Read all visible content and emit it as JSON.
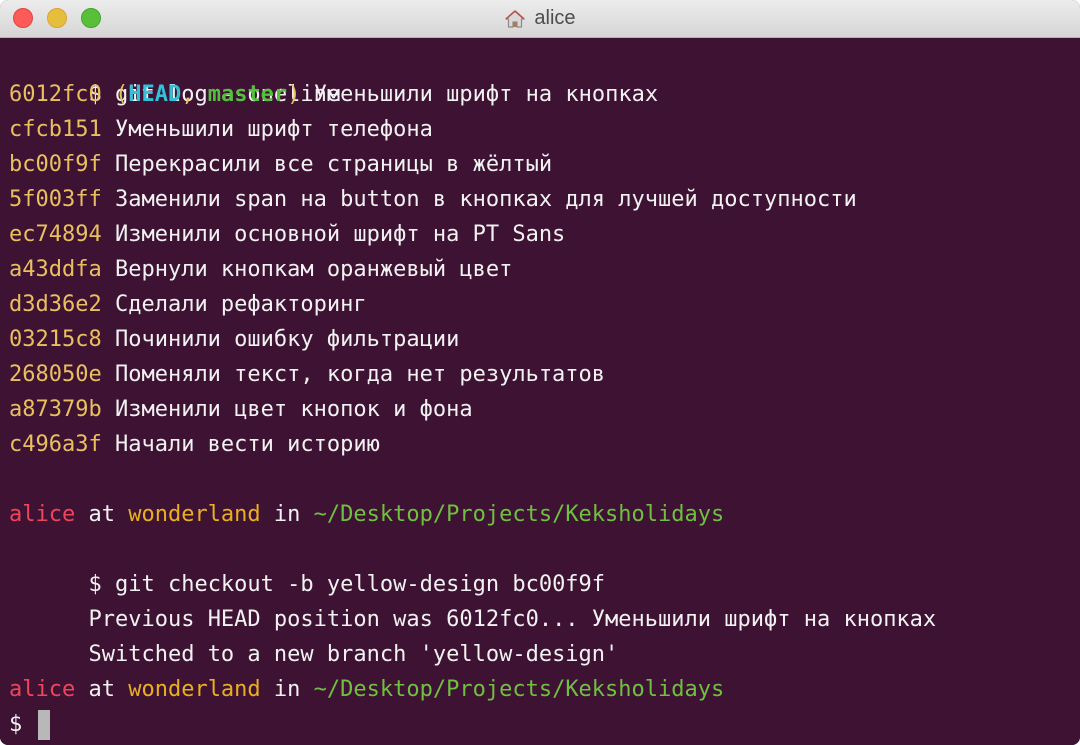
{
  "window": {
    "title": "alice",
    "colors": {
      "background": "#3e1233",
      "text": "#f2f2f2",
      "hash": "#e8c060",
      "head": "#33c0d8",
      "branch": "#55c040",
      "user": "#f0445c",
      "host": "#e8b020",
      "path": "#70c040"
    },
    "icon": "home-icon"
  },
  "terminal": {
    "command1": "$ git log --oneline",
    "log": [
      {
        "hash": "6012fc0",
        "message": "Уменьшили шрифт на кнопках"
      },
      {
        "hash": "cfcb151",
        "message": "Уменьшили шрифт телефона"
      },
      {
        "hash": "bc00f9f",
        "message": "Перекрасили все страницы в жёлтый"
      },
      {
        "hash": "5f003ff",
        "message": "Заменили span на button в кнопках для лучшей доступности"
      },
      {
        "hash": "ec74894",
        "message": "Изменили основной шрифт на PT Sans"
      },
      {
        "hash": "a43ddfa",
        "message": "Вернули кнопкам оранжевый цвет"
      },
      {
        "hash": "d3d36e2",
        "message": "Сделали рефакторинг"
      },
      {
        "hash": "03215c8",
        "message": "Починили ошибку фильтрации"
      },
      {
        "hash": "268050e",
        "message": "Поменяли текст, когда нет результатов"
      },
      {
        "hash": "a87379b",
        "message": "Изменили цвет кнопок и фона"
      },
      {
        "hash": "c496a3f",
        "message": "Начали вести историю"
      }
    ],
    "decoration": {
      "open": "(",
      "head": "HEAD",
      "separator": ", ",
      "branch": "master",
      "close": ")"
    },
    "prompt": {
      "user": "alice",
      "at": " at ",
      "host": "wonderland",
      "in": " in ",
      "path": "~/Desktop/Projects/Keksholidays"
    },
    "command2": "$ git checkout -b yellow-design bc00f9f",
    "output1": "Previous HEAD position was 6012fc0... Уменьшили шрифт на кнопках",
    "output2": "Switched to a new branch 'yellow-design'",
    "prompt_symbol": "$ "
  }
}
